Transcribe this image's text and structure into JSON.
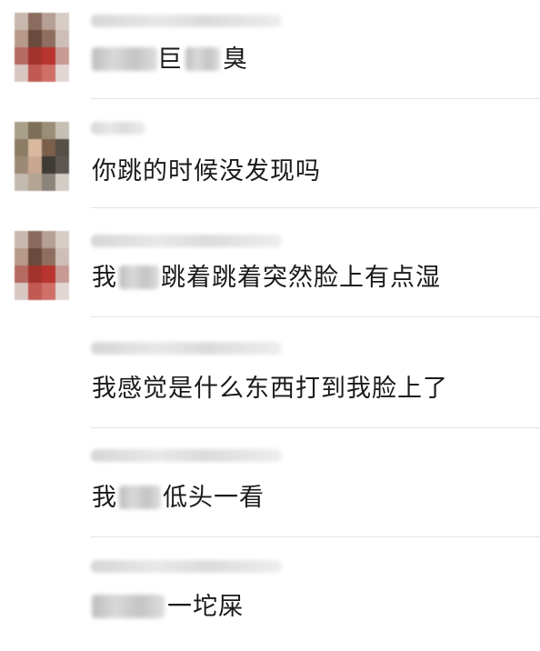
{
  "messages": [
    {
      "avatar": "blurred-avatar-red-shirt",
      "segments": [
        "巨",
        "臭"
      ]
    },
    {
      "avatar": "blurred-avatar-dark",
      "segments": [
        "你跳的时候没发现吗"
      ]
    },
    {
      "avatar": "blurred-avatar-red-shirt",
      "segments": [
        "我",
        "跳着跳着突然脸上有点湿"
      ]
    },
    {
      "avatar": "",
      "segments": [
        "我感觉是什么东西打到我脸上了"
      ]
    },
    {
      "avatar": "",
      "segments": [
        "我",
        "低头一看"
      ]
    },
    {
      "avatar": "",
      "segments": [
        "一坨屎"
      ]
    }
  ]
}
